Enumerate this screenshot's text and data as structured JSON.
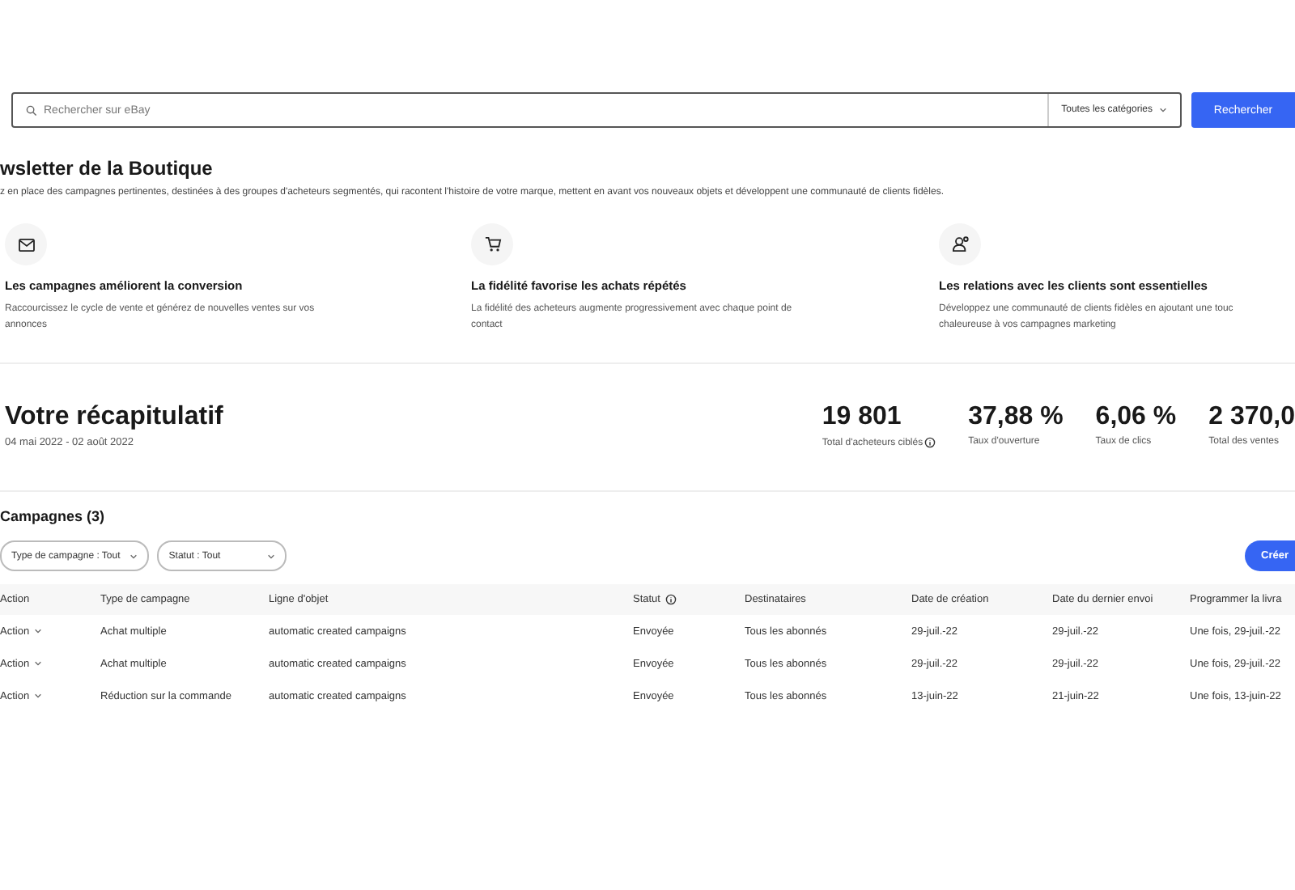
{
  "search": {
    "placeholder": "Rechercher sur eBay",
    "category": "Toutes les catégories",
    "button": "Rechercher"
  },
  "header": {
    "title": "wsletter de la Boutique",
    "description": "z en place des campagnes pertinentes, destinées à des groupes d'acheteurs segmentés, qui racontent l'histoire de votre marque, mettent en avant vos nouveaux objets et développent une communauté de clients fidèles."
  },
  "benefits": [
    {
      "kind": "mail",
      "title": "Les campagnes améliorent la conversion",
      "text": "Raccourcissez le cycle de vente et générez de nouvelles ventes sur vos\nannonces"
    },
    {
      "kind": "cart",
      "title": "La fidélité favorise les achats répétés",
      "text": "La fidélité des acheteurs augmente progressivement avec chaque point de\ncontact"
    },
    {
      "kind": "person",
      "title": "Les relations avec les clients sont essentielles",
      "text": "Développez une communauté de clients fidèles en ajoutant une touc\nchaleureuse à vos campagnes marketing"
    }
  ],
  "summary": {
    "title": "Votre récapitulatif",
    "period": "04 mai 2022 - 02 août 2022",
    "stats": [
      {
        "value": "19 801",
        "label": "Total d'acheteurs ciblés",
        "info": true
      },
      {
        "value": "37,88 %",
        "label": "Taux d'ouverture",
        "info": false
      },
      {
        "value": "6,06 %",
        "label": "Taux de clics",
        "info": false
      },
      {
        "value": "2 370,0",
        "label": "Total des ventes",
        "info": false
      }
    ]
  },
  "campaigns": {
    "title": "Campagnes (3)",
    "filters": [
      "Type de campagne : Tout",
      "Statut : Tout"
    ],
    "create_button": "Créer",
    "columns": [
      {
        "label": "Action",
        "info": false
      },
      {
        "label": "Type de campagne",
        "info": false
      },
      {
        "label": "Ligne d'objet",
        "info": false
      },
      {
        "label": "Statut",
        "info": true
      },
      {
        "label": "Destinataires",
        "info": false
      },
      {
        "label": "Date de création",
        "info": false
      },
      {
        "label": "Date du dernier envoi",
        "info": false
      },
      {
        "label": "Programmer la livra",
        "info": false
      }
    ],
    "rows": [
      [
        "Action",
        "Achat multiple",
        "automatic created campaigns",
        "Envoyée",
        "Tous les abonnés",
        "29-juil.-22",
        "29-juil.-22",
        "Une fois, 29-juil.-22"
      ],
      [
        "Action",
        "Achat multiple",
        "automatic created campaigns",
        "Envoyée",
        "Tous les abonnés",
        "29-juil.-22",
        "29-juil.-22",
        "Une fois, 29-juil.-22"
      ],
      [
        "Action",
        "Réduction sur la commande",
        "automatic created campaigns",
        "Envoyée",
        "Tous les abonnés",
        "13-juin-22",
        "21-juin-22",
        "Une fois, 13-juin-22"
      ]
    ]
  }
}
